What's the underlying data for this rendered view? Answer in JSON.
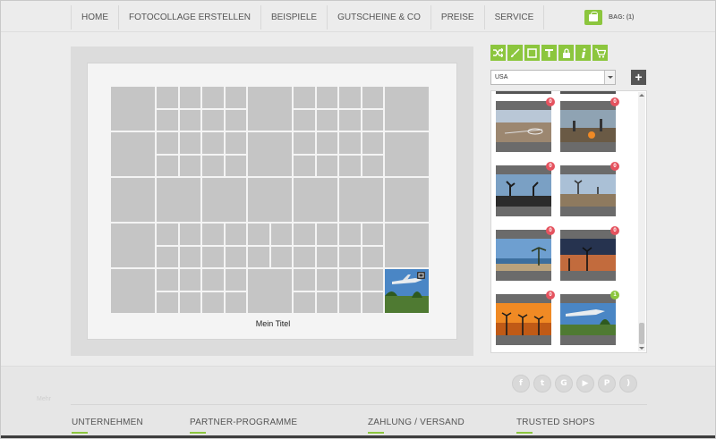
{
  "nav": {
    "items": [
      {
        "label": "HOME",
        "name": "nav-home"
      },
      {
        "label": "FOTOCOLLAGE ERSTELLEN",
        "name": "nav-fotocollage-erstellen"
      },
      {
        "label": "BEISPIELE",
        "name": "nav-beispiele"
      },
      {
        "label": "GUTSCHEINE & CO",
        "name": "nav-gutscheine"
      },
      {
        "label": "PREISE",
        "name": "nav-preise"
      },
      {
        "label": "SERVICE",
        "name": "nav-service"
      }
    ],
    "bag_label": "BAG: (1)",
    "bag_icon": "shopping-bag-icon"
  },
  "canvas": {
    "title": "Mein Titel"
  },
  "toolbar": {
    "tools": [
      {
        "icon": "shuffle-icon"
      },
      {
        "icon": "brush-icon"
      },
      {
        "icon": "frame-icon"
      },
      {
        "icon": "text-icon"
      },
      {
        "icon": "lock-icon"
      },
      {
        "icon": "info-icon"
      },
      {
        "icon": "cart-icon"
      }
    ],
    "accent_color": "#8cc63e"
  },
  "album_select": {
    "selected": "USA"
  },
  "add_button": "+",
  "gallery": {
    "thumbs": [
      {
        "badge": "0",
        "scene": "court"
      },
      {
        "badge": "0",
        "scene": "campfire"
      },
      {
        "badge": "0",
        "scene": "joshua"
      },
      {
        "badge": "0",
        "scene": "desert"
      },
      {
        "badge": "0",
        "scene": "beach"
      },
      {
        "badge": "0",
        "scene": "dusk"
      },
      {
        "badge": "0",
        "scene": "sunset"
      },
      {
        "badge": "1",
        "scene": "plane",
        "used": true
      }
    ]
  },
  "footer": {
    "tiny": "Mehr",
    "social": [
      "facebook-icon",
      "twitter-icon",
      "google-icon",
      "youtube-icon",
      "pinterest-icon",
      "rss-icon"
    ],
    "headings": [
      {
        "label": "UNTERNEHMEN",
        "name": "footer-heading-unternehmen"
      },
      {
        "label": "PARTNER-PROGRAMME",
        "name": "footer-heading-partner-programme"
      },
      {
        "label": "ZAHLUNG / VERSAND",
        "name": "footer-heading-zahlung-versand"
      },
      {
        "label": "TRUSTED SHOPS",
        "name": "footer-heading-trusted-shops"
      }
    ]
  }
}
